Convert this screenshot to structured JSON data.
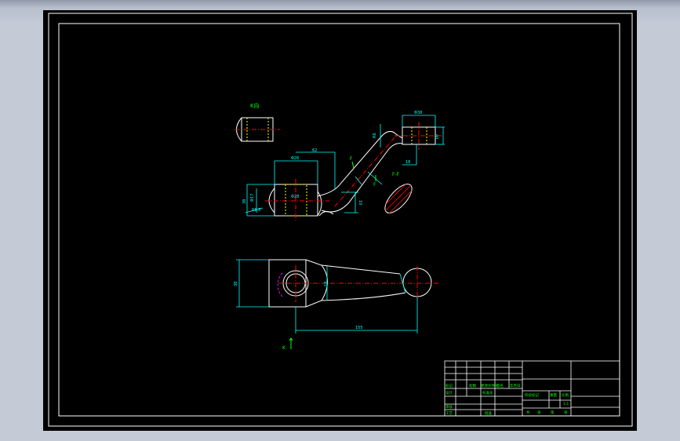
{
  "viewport": {
    "background_color": "#c4cad6"
  },
  "drawing": {
    "sheet_color": "#000000",
    "frame_color": "#ffffff",
    "geometry_color": "#ffffff",
    "dimension_color": "#00ffff",
    "label_color": "#00ff00",
    "centerline_color": "#ff0000",
    "hidden_color": "#ffff00",
    "hatch_color": "#ff0000",
    "hidden_circle_color": "#ff00ff",
    "labels": {
      "view_k": "K向",
      "section_mark_top": "F",
      "section_mark_bottom": "F",
      "section_view": "F-F",
      "view_arrow": "K"
    },
    "dimensions": {
      "top_width": "Φ38",
      "top_height": "40",
      "top_offset": "R6",
      "top_depth": "18",
      "angle": "62",
      "boss_width": "Φ26",
      "boss_bore": "Φ28",
      "boss_height": "38",
      "boss_left": "Φ17",
      "boss_radius": "R6.5",
      "arm_offset": "10",
      "bottom_height": "38",
      "bottom_length": "155",
      "bottom_tip": "18"
    }
  },
  "title_block": {
    "cells": [
      "标记",
      "处数",
      "更改文件号",
      "签名",
      "年月日",
      "设计",
      "标准化",
      "审核",
      "工艺",
      "批准",
      "阶段标记",
      "重量",
      "比例",
      "1:1",
      "共",
      "张",
      "第",
      "张"
    ]
  }
}
